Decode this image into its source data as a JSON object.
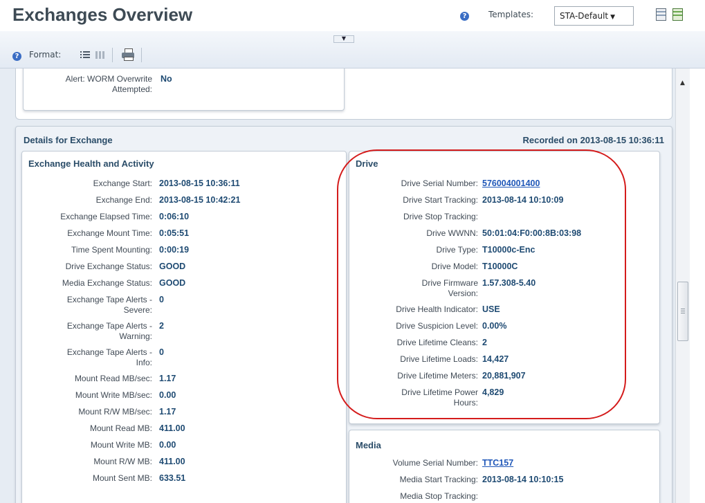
{
  "page": {
    "title": "Exchanges Overview"
  },
  "templates": {
    "label": "Templates:",
    "selected": "STA-Default"
  },
  "toolbar": {
    "format_label": "Format:"
  },
  "worm_alert": {
    "label_line1": "Alert: WORM Overwrite",
    "label_line2": "Attempted:",
    "value": "No"
  },
  "details": {
    "title": "Details for Exchange",
    "recorded": "Recorded on 2013-08-15 10:36:11"
  },
  "health": {
    "title": "Exchange Health and Activity",
    "rows": [
      {
        "label": "Exchange Start:",
        "value": "2013-08-15 10:36:11"
      },
      {
        "label": "Exchange End:",
        "value": "2013-08-15 10:42:21"
      },
      {
        "label": "Exchange Elapsed Time:",
        "value": "0:06:10"
      },
      {
        "label": "Exchange Mount Time:",
        "value": "0:05:51"
      },
      {
        "label": "Time Spent Mounting:",
        "value": "0:00:19"
      },
      {
        "label": "Drive Exchange Status:",
        "value": "GOOD"
      },
      {
        "label": "Media Exchange Status:",
        "value": "GOOD"
      },
      {
        "label": "Exchange Tape Alerts -",
        "label2": "Severe:",
        "value": "0"
      },
      {
        "label": "Exchange Tape Alerts -",
        "label2": "Warning:",
        "value": "2"
      },
      {
        "label": "Exchange Tape Alerts -",
        "label2": "Info:",
        "value": "0"
      },
      {
        "label": "Mount Read MB/sec:",
        "value": "1.17"
      },
      {
        "label": "Mount Write MB/sec:",
        "value": "0.00"
      },
      {
        "label": "Mount R/W MB/sec:",
        "value": "1.17"
      },
      {
        "label": "Mount Read MB:",
        "value": "411.00"
      },
      {
        "label": "Mount Write MB:",
        "value": "0.00"
      },
      {
        "label": "Mount R/W MB:",
        "value": "411.00"
      },
      {
        "label": "Mount Sent MB:",
        "value": "633.51"
      }
    ]
  },
  "drive": {
    "title": "Drive",
    "rows": [
      {
        "label": "Drive Serial Number:",
        "value": "576004001400"
      },
      {
        "label": "Drive Start Tracking:",
        "value": "2013-08-14 10:10:09"
      },
      {
        "label": "Drive Stop Tracking:",
        "value": ""
      },
      {
        "label": "Drive WWNN:",
        "value": "50:01:04:F0:00:8B:03:98"
      },
      {
        "label": "Drive Type:",
        "value": "T10000c-Enc"
      },
      {
        "label": "Drive Model:",
        "value": "T10000C"
      },
      {
        "label": "Drive Firmware",
        "label2": "Version:",
        "value": "1.57.308-5.40"
      },
      {
        "label": "Drive Health Indicator:",
        "value": "USE"
      },
      {
        "label": "Drive Suspicion Level:",
        "value": "0.00%"
      },
      {
        "label": "Drive Lifetime Cleans:",
        "value": "2"
      },
      {
        "label": "Drive Lifetime Loads:",
        "value": "14,427"
      },
      {
        "label": "Drive Lifetime Meters:",
        "value": "20,881,907"
      },
      {
        "label": "Drive Lifetime Power",
        "label2": "Hours:",
        "value": "4,829"
      }
    ]
  },
  "media": {
    "title": "Media",
    "rows": [
      {
        "label": "Volume Serial Number:",
        "value": "TTC157"
      },
      {
        "label": "Media Start Tracking:",
        "value": "2013-08-14 10:10:15"
      },
      {
        "label": "Media Stop Tracking:",
        "value": ""
      }
    ]
  },
  "colors": {
    "accent": "#1e4a72",
    "link": "#1f57b8",
    "callout": "#d41b1b",
    "page_bg": "#e6ecf3"
  },
  "icons": [
    "help-icon",
    "list-view-icon",
    "grid-view-icon",
    "print-icon",
    "save-template-icon",
    "export-template-icon",
    "scroll-up-arrow"
  ]
}
